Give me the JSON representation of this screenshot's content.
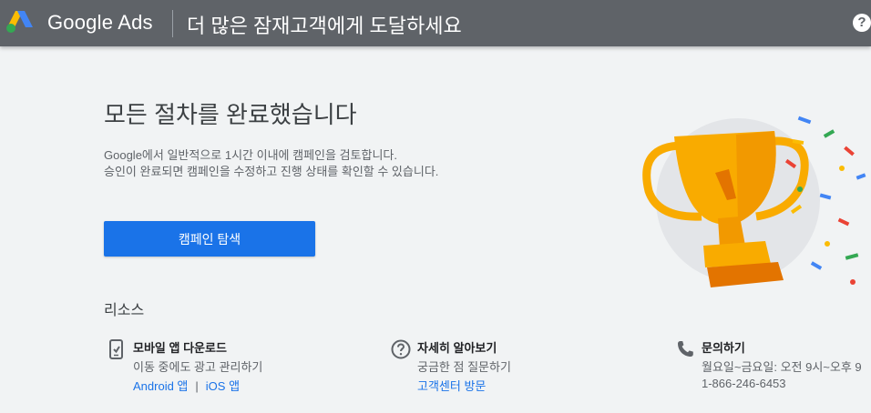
{
  "header": {
    "brand": "Google Ads",
    "tagline": "더 많은 잠재고객에게 도달하세요",
    "help_glyph": "?"
  },
  "main": {
    "heading": "모든 절차를 완료했습니다",
    "description_lines": [
      "Google에서 일반적으로 1시간 이내에 캠페인을 검토합니다.",
      "승인이 완료되면 캠페인을 수정하고 진행 상태를 확인할 수 있습니다."
    ],
    "cta_label": "캠페인 탐색"
  },
  "resources": {
    "title": "리소스",
    "mobile": {
      "title": "모바일 앱 다운로드",
      "subtitle": "이동 중에도 광고 관리하기",
      "android_label": "Android 앱",
      "separator": "|",
      "ios_label": "iOS 앱"
    },
    "learn": {
      "title": "자세히 알아보기",
      "subtitle": "궁금한 점 질문하기",
      "link_label": "고객센터 방문"
    },
    "contact": {
      "title": "문의하기",
      "hours": "월요일~금요일: 오전 9시~오후 9",
      "phone": "1-866-246-6453"
    }
  },
  "colors": {
    "topbar": "#5f6368",
    "primary": "#1a73e8",
    "background": "#f1f3f4",
    "trophy_gold": "#f9ab00"
  }
}
